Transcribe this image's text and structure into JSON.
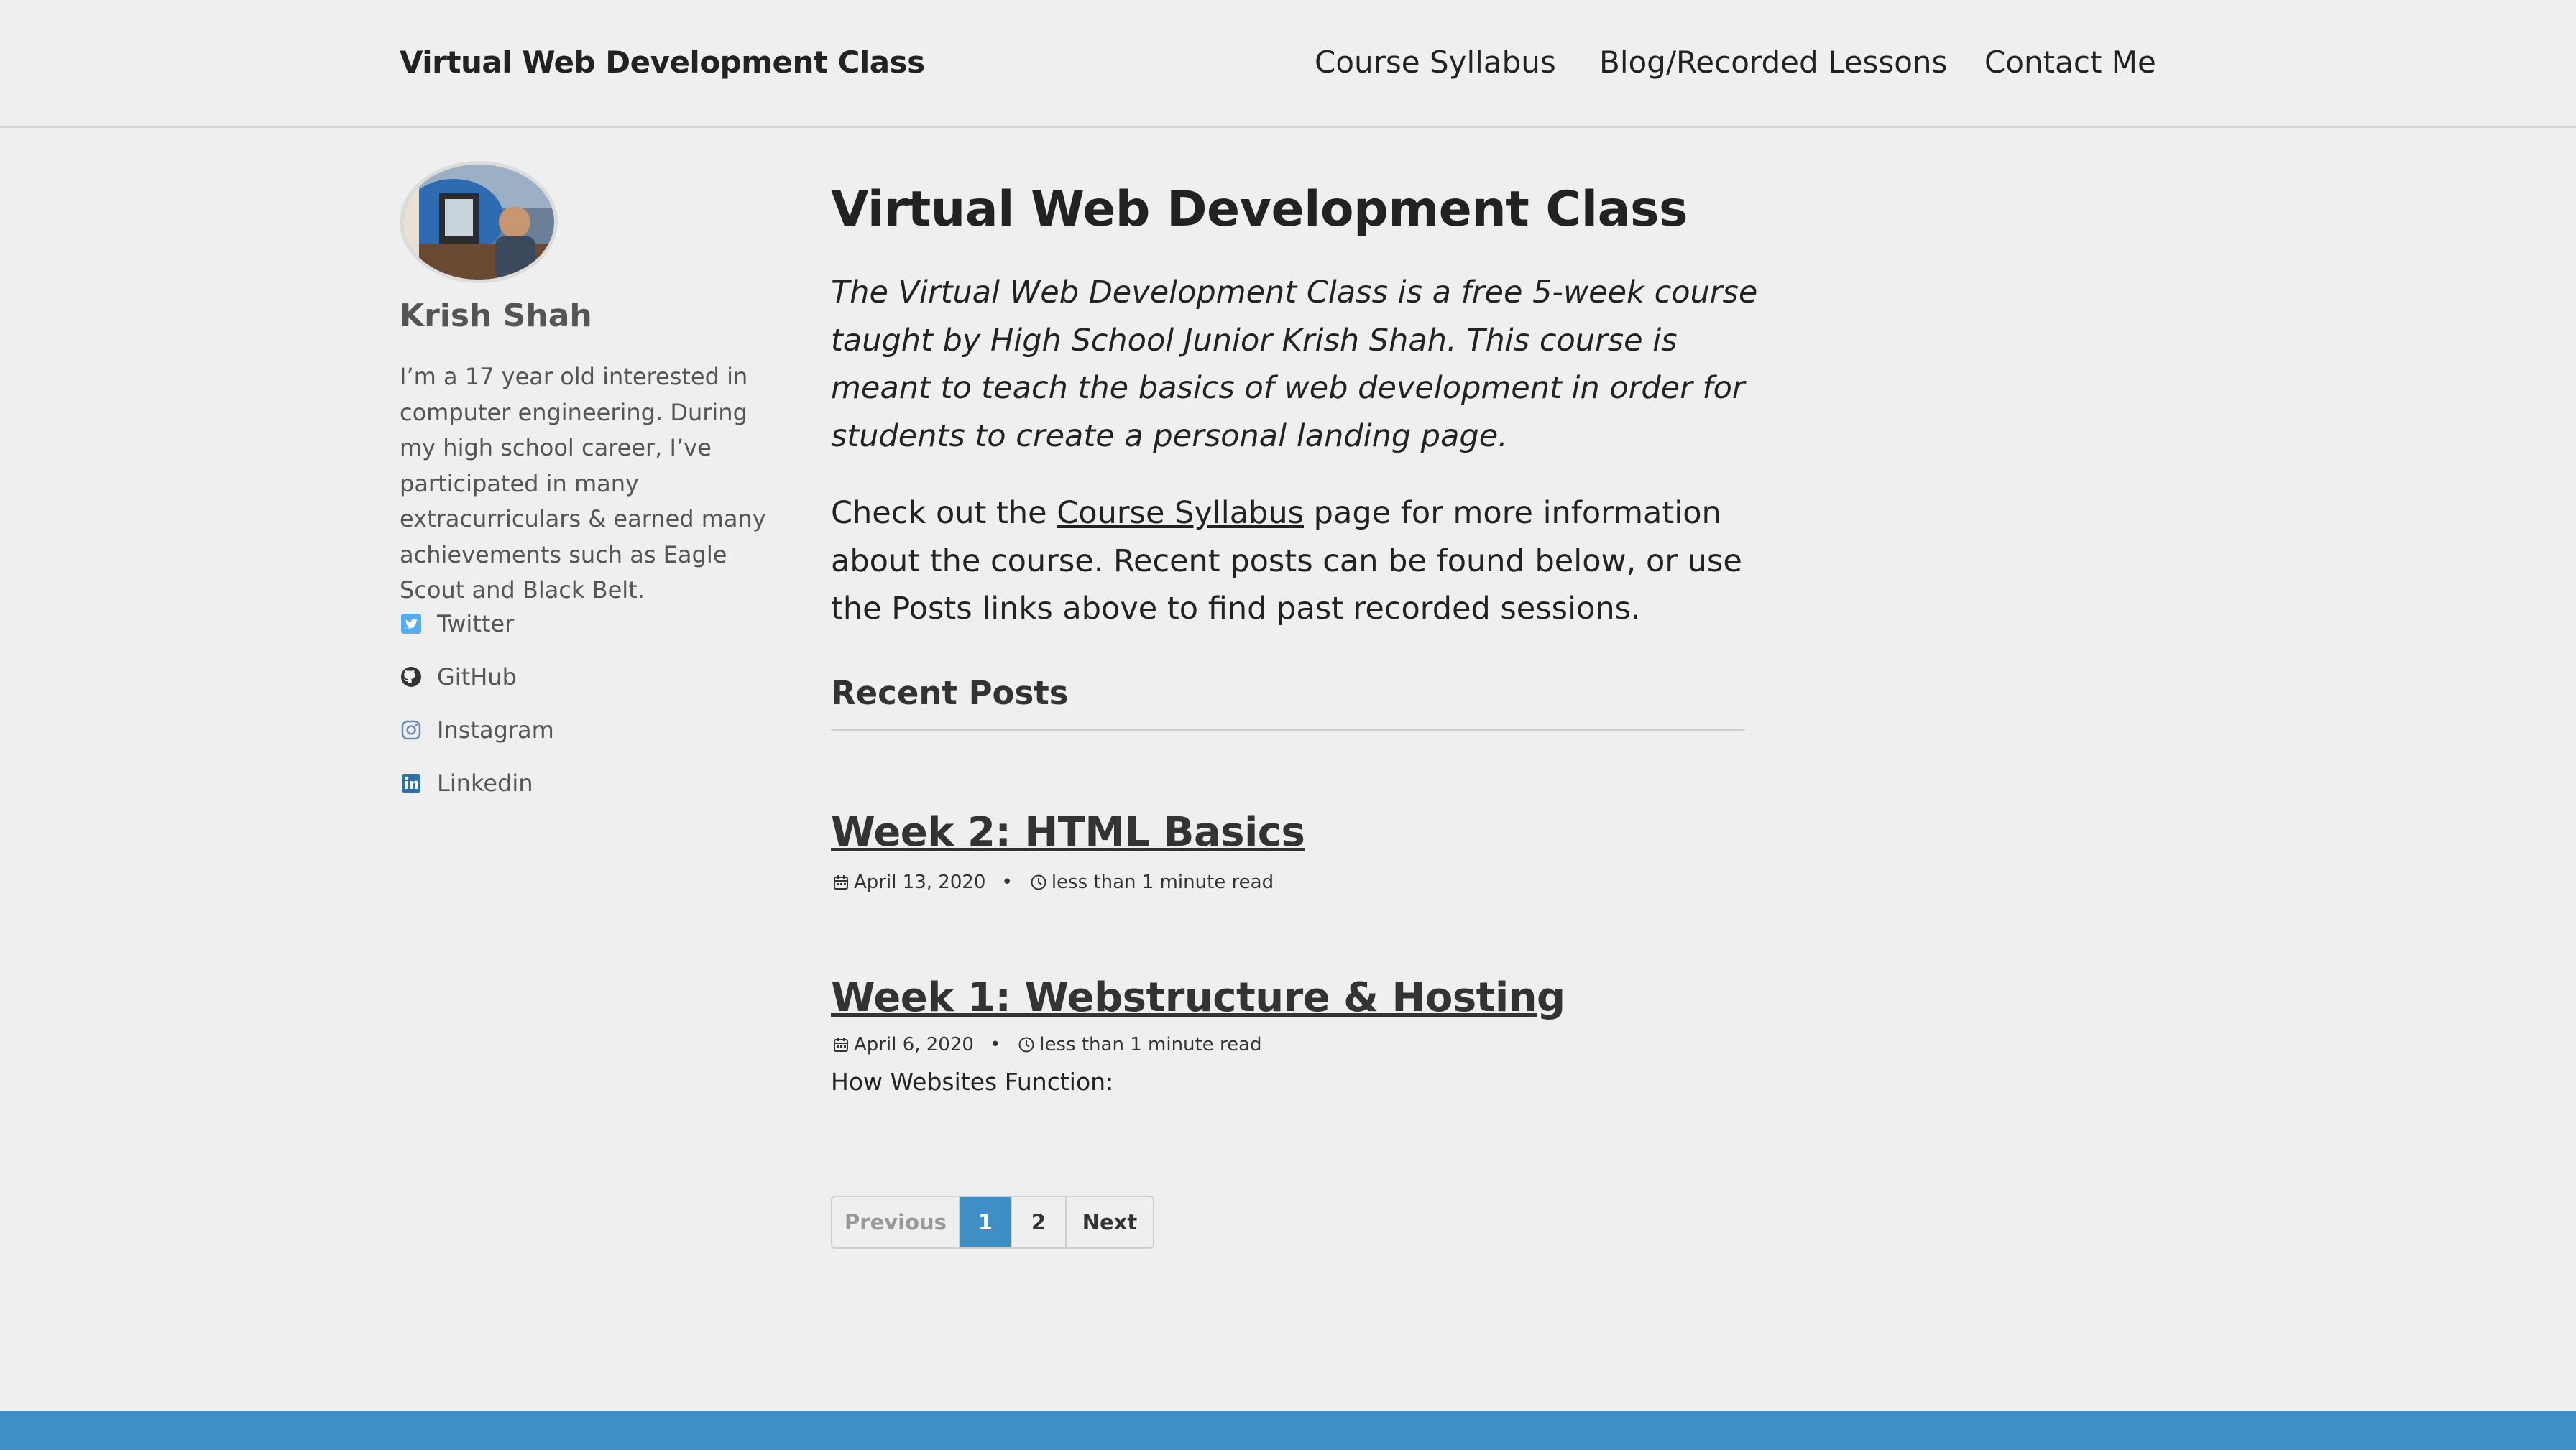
{
  "masthead": {
    "site_title": "Virtual Web Development Class",
    "nav": [
      {
        "label": "Course Syllabus"
      },
      {
        "label": "Blog/Recorded Lessons"
      },
      {
        "label": "Contact Me"
      }
    ]
  },
  "sidebar": {
    "author_name": "Krish Shah",
    "bio": "I’m a 17 year old interested in computer engineering. During my high school career, I’ve participated in many extracurriculars & earned many achievements such as Eagle Scout and Black Belt.",
    "links": [
      {
        "label": "Twitter",
        "icon": "twitter-icon"
      },
      {
        "label": "GitHub",
        "icon": "github-icon"
      },
      {
        "label": "Instagram",
        "icon": "instagram-icon"
      },
      {
        "label": "Linkedin",
        "icon": "linkedin-icon"
      }
    ]
  },
  "main": {
    "title": "Virtual Web Development Class",
    "intro": "The Virtual Web Development Class is a free 5-week course taught by High School Junior Krish Shah. This course is meant to teach the basics of web development in order for students to create a personal landing page.",
    "body_before_link": "Check out the ",
    "body_link": "Course Syllabus",
    "body_after_link": " page for more information about the course. Recent posts can be found below, or use the Posts links above to find past recorded sessions.",
    "recent_posts_title": "Recent Posts",
    "posts": [
      {
        "title": "Week 2: HTML Basics",
        "date": "April 13, 2020",
        "read_time": "less than 1 minute read",
        "excerpt": ""
      },
      {
        "title": "Week 1: Webstructure & Hosting",
        "date": "April 6, 2020",
        "read_time": "less than 1 minute read",
        "excerpt": "How Websites Function:"
      }
    ],
    "meta_separator": "•"
  },
  "pagination": {
    "previous": "Previous",
    "pages": [
      "1",
      "2"
    ],
    "current_page": "1",
    "next": "Next"
  },
  "colors": {
    "accent": "#3d8fc6",
    "background": "#efefef",
    "text": "#222222",
    "muted": "#555555"
  }
}
